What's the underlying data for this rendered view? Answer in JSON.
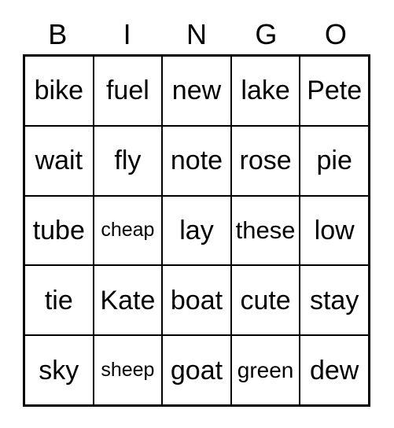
{
  "card": {
    "title": "BINGO",
    "header": {
      "letters": [
        {
          "label": "B"
        },
        {
          "label": "I"
        },
        {
          "label": "N"
        },
        {
          "label": "G"
        },
        {
          "label": "O"
        }
      ]
    },
    "colors": {
      "border": "#000000",
      "cell_background": "#ffffff",
      "text": "#000000",
      "page_background": "#ffffff"
    },
    "grid": {
      "columns": 5,
      "rows": 5,
      "free_space": false,
      "cells": [
        [
          {
            "text": "bike",
            "size": "fs-lg"
          },
          {
            "text": "fuel",
            "size": "fs-lg"
          },
          {
            "text": "new",
            "size": "fs-lg"
          },
          {
            "text": "lake",
            "size": "fs-lg"
          },
          {
            "text": "Pete",
            "size": "fs-lg"
          }
        ],
        [
          {
            "text": "wait",
            "size": "fs-lg"
          },
          {
            "text": "fly",
            "size": "fs-lg"
          },
          {
            "text": "note",
            "size": "fs-lg"
          },
          {
            "text": "rose",
            "size": "fs-lg"
          },
          {
            "text": "pie",
            "size": "fs-lg"
          }
        ],
        [
          {
            "text": "tube",
            "size": "fs-lg"
          },
          {
            "text": "cheap",
            "size": "fs-xs"
          },
          {
            "text": "lay",
            "size": "fs-lg"
          },
          {
            "text": "these",
            "size": "fs-md"
          },
          {
            "text": "low",
            "size": "fs-lg"
          }
        ],
        [
          {
            "text": "tie",
            "size": "fs-lg"
          },
          {
            "text": "Kate",
            "size": "fs-lg"
          },
          {
            "text": "boat",
            "size": "fs-lg"
          },
          {
            "text": "cute",
            "size": "fs-lg"
          },
          {
            "text": "stay",
            "size": "fs-lg"
          }
        ],
        [
          {
            "text": "sky",
            "size": "fs-lg"
          },
          {
            "text": "sheep",
            "size": "fs-xs"
          },
          {
            "text": "goat",
            "size": "fs-lg"
          },
          {
            "text": "green",
            "size": "fs-sm"
          },
          {
            "text": "dew",
            "size": "fs-lg"
          }
        ]
      ]
    }
  }
}
